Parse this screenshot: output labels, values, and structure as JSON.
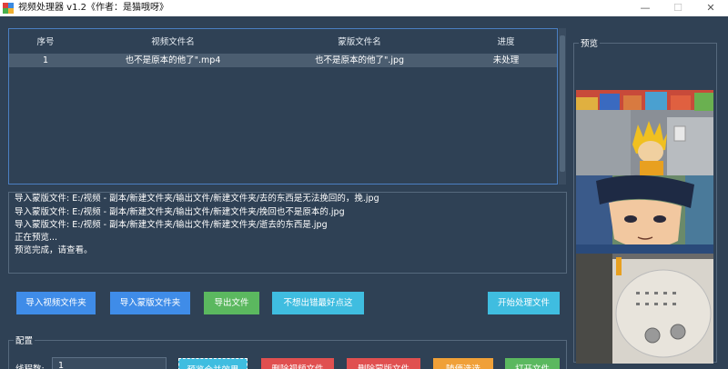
{
  "window": {
    "title": "视频处理器 v1.2《作者：是猫哦呀》",
    "minimize_glyph": "—",
    "maximize_glyph": "☐",
    "close_glyph": "✕"
  },
  "table": {
    "headers": [
      "序号",
      "视频文件名",
      "蒙版文件名",
      "进度"
    ],
    "rows": [
      {
        "index": "1",
        "video": "也不是原本的他了\".mp4",
        "mask": "也不是原本的他了\".jpg",
        "progress": "未处理"
      }
    ]
  },
  "log": {
    "lines": [
      "导入蒙版文件: E:/视频 - 副本/新建文件夹/输出文件/新建文件夹/去的东西是无法挽回的，挽.jpg",
      "导入蒙版文件: E:/视频 - 副本/新建文件夹/输出文件/新建文件夹/挽回也不是原本的.jpg",
      "导入蒙版文件: E:/视频 - 副本/新建文件夹/输出文件/新建文件夹/逝去的东西是.jpg",
      "正在预览...",
      "预览完成，请查看。"
    ]
  },
  "buttons": {
    "import_video": "导入视频文件夹",
    "import_mask": "导入蒙版文件夹",
    "export": "导出文件",
    "suggestions": "不想出错最好点这",
    "start": "开始处理文件",
    "preview_merge": "预览合并效果",
    "delete_video": "删除视频文件",
    "delete_mask": "删除蒙版文件",
    "change_style": "随便选选",
    "open_file": "打开文件"
  },
  "config": {
    "title": "配置",
    "threads_label": "线程数:",
    "threads_value": "1"
  },
  "preview": {
    "title": "预览"
  },
  "colors": {
    "background": "#2f4155",
    "row_selected": "#4b5d70",
    "table_border": "#4b7fc2",
    "blue": "#3f8ce8",
    "green": "#5bb85f",
    "cyan": "#3fbde0",
    "red": "#e05050",
    "orange": "#f0a038"
  }
}
